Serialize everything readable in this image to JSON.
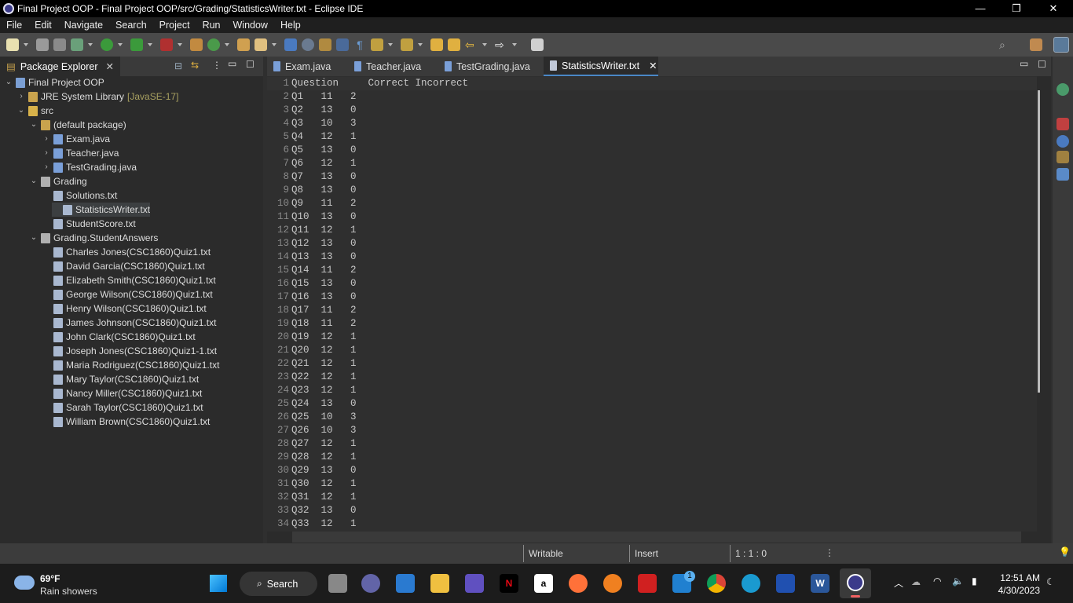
{
  "window": {
    "title": "Final Project OOP - Final Project OOP/src/Grading/StatisticsWriter.txt - Eclipse IDE",
    "minimize": "—",
    "maximize": "❐",
    "close": "✕"
  },
  "menu": [
    "File",
    "Edit",
    "Navigate",
    "Search",
    "Project",
    "Run",
    "Window",
    "Help"
  ],
  "package_explorer": {
    "title": "Package Explorer",
    "tree": [
      {
        "label": "Final Project OOP",
        "depth": 0,
        "chev": "v",
        "icon": "project-icon",
        "color": "#7b9fd4"
      },
      {
        "label": "JRE System Library",
        "suffix": "[JavaSE-17]",
        "depth": 1,
        "chev": ">",
        "icon": "library-icon",
        "color": "#c9a34d"
      },
      {
        "label": "src",
        "depth": 1,
        "chev": "v",
        "icon": "source-folder-icon",
        "color": "#d8b24a"
      },
      {
        "label": "(default package)",
        "depth": 2,
        "chev": "v",
        "icon": "package-icon",
        "color": "#c9a34d"
      },
      {
        "label": "Exam.java",
        "depth": 3,
        "chev": ">",
        "icon": "java-file-icon",
        "color": "#7a9fd8"
      },
      {
        "label": "Teacher.java",
        "depth": 3,
        "chev": ">",
        "icon": "java-file-icon",
        "color": "#7a9fd8"
      },
      {
        "label": "TestGrading.java",
        "depth": 3,
        "chev": ">",
        "icon": "java-file-icon",
        "color": "#7a9fd8"
      },
      {
        "label": "Grading",
        "depth": 2,
        "chev": "v",
        "icon": "package-icon",
        "color": "#b0b0b0"
      },
      {
        "label": "Solutions.txt",
        "depth": 3,
        "chev": "",
        "icon": "text-file-icon",
        "color": "#a9b8d0"
      },
      {
        "label": "StatisticsWriter.txt",
        "depth": 3,
        "chev": "",
        "icon": "text-file-icon",
        "color": "#a9b8d0",
        "selected": true
      },
      {
        "label": "StudentScore.txt",
        "depth": 3,
        "chev": "",
        "icon": "text-file-icon",
        "color": "#a9b8d0"
      },
      {
        "label": "Grading.StudentAnswers",
        "depth": 2,
        "chev": "v",
        "icon": "package-icon",
        "color": "#b0b0b0"
      },
      {
        "label": "Charles Jones(CSC1860)Quiz1.txt",
        "depth": 3,
        "chev": "",
        "icon": "text-file-icon",
        "color": "#a9b8d0"
      },
      {
        "label": "David Garcia(CSC1860)Quiz1.txt",
        "depth": 3,
        "chev": "",
        "icon": "text-file-icon",
        "color": "#a9b8d0"
      },
      {
        "label": "Elizabeth Smith(CSC1860)Quiz1.txt",
        "depth": 3,
        "chev": "",
        "icon": "text-file-icon",
        "color": "#a9b8d0"
      },
      {
        "label": "George Wilson(CSC1860)Quiz1.txt",
        "depth": 3,
        "chev": "",
        "icon": "text-file-icon",
        "color": "#a9b8d0"
      },
      {
        "label": "Henry Wilson(CSC1860)Quiz1.txt",
        "depth": 3,
        "chev": "",
        "icon": "text-file-icon",
        "color": "#a9b8d0"
      },
      {
        "label": "James Johnson(CSC1860)Quiz1.txt",
        "depth": 3,
        "chev": "",
        "icon": "text-file-icon",
        "color": "#a9b8d0"
      },
      {
        "label": "John Clark(CSC1860)Quiz1.txt",
        "depth": 3,
        "chev": "",
        "icon": "text-file-icon",
        "color": "#a9b8d0"
      },
      {
        "label": "Joseph Jones(CSC1860)Quiz1-1.txt",
        "depth": 3,
        "chev": "",
        "icon": "text-file-icon",
        "color": "#a9b8d0"
      },
      {
        "label": "Maria Rodriguez(CSC1860)Quiz1.txt",
        "depth": 3,
        "chev": "",
        "icon": "text-file-icon",
        "color": "#a9b8d0"
      },
      {
        "label": "Mary Taylor(CSC1860)Quiz1.txt",
        "depth": 3,
        "chev": "",
        "icon": "text-file-icon",
        "color": "#a9b8d0"
      },
      {
        "label": "Nancy Miller(CSC1860)Quiz1.txt",
        "depth": 3,
        "chev": "",
        "icon": "text-file-icon",
        "color": "#a9b8d0"
      },
      {
        "label": "Sarah Taylor(CSC1860)Quiz1.txt",
        "depth": 3,
        "chev": "",
        "icon": "text-file-icon",
        "color": "#a9b8d0"
      },
      {
        "label": "William Brown(CSC1860)Quiz1.txt",
        "depth": 3,
        "chev": "",
        "icon": "text-file-icon",
        "color": "#a9b8d0"
      }
    ]
  },
  "editor": {
    "tabs": [
      {
        "label": "Exam.java"
      },
      {
        "label": "Teacher.java"
      },
      {
        "label": "TestGrading.java"
      },
      {
        "label": "StatisticsWriter.txt",
        "active": true,
        "close": "✕"
      }
    ],
    "lines": [
      "Question     Correct Incorrect",
      "Q1   11   2",
      "Q2   13   0",
      "Q3   10   3",
      "Q4   12   1",
      "Q5   13   0",
      "Q6   12   1",
      "Q7   13   0",
      "Q8   13   0",
      "Q9   11   2",
      "Q10  13   0",
      "Q11  12   1",
      "Q12  13   0",
      "Q13  13   0",
      "Q14  11   2",
      "Q15  13   0",
      "Q16  13   0",
      "Q17  11   2",
      "Q18  11   2",
      "Q19  12   1",
      "Q20  12   1",
      "Q21  12   1",
      "Q22  12   1",
      "Q23  12   1",
      "Q24  13   0",
      "Q25  10   3",
      "Q26  10   3",
      "Q27  12   1",
      "Q28  12   1",
      "Q29  13   0",
      "Q30  12   1",
      "Q31  12   1",
      "Q32  13   0",
      "Q33  12   1"
    ]
  },
  "status": {
    "writable": "Writable",
    "insert": "Insert",
    "position": "1 : 1 : 0"
  },
  "taskbar": {
    "weather_temp": "69°F",
    "weather_desc": "Rain showers",
    "search": "Search",
    "time": "12:51 AM",
    "date": "4/30/2023",
    "mail_badge": "1"
  }
}
